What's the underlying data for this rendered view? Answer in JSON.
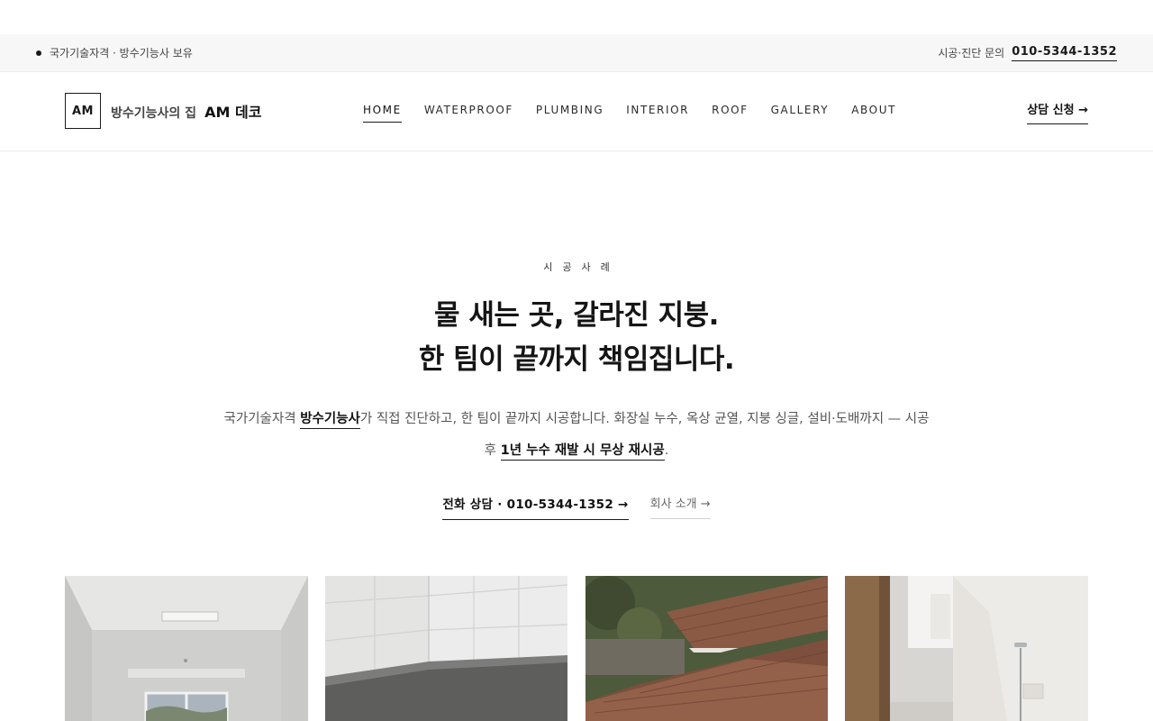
{
  "topbar": {
    "badge_text": "국가기술자격 · 방수기능사 보유",
    "inquiry_label": "시공·진단 문의",
    "phone": "010-5344-1352"
  },
  "header": {
    "logo_mark": "AM",
    "brand_prefix": "방수기능사의 집",
    "brand_name": "AM 데코",
    "nav": [
      {
        "label": "HOME",
        "active": true
      },
      {
        "label": "WATERPROOF"
      },
      {
        "label": "PLUMBING"
      },
      {
        "label": "INTERIOR"
      },
      {
        "label": "ROOF"
      },
      {
        "label": "GALLERY"
      },
      {
        "label": "ABOUT"
      }
    ],
    "cta_label": "상담 신청 →"
  },
  "hero": {
    "eyebrow": "시공사례",
    "headline_line1": "물 새는 곳, 갈라진 지붕.",
    "headline_line2": "한 팀이 끝까지 책임집니다.",
    "desc_part1": "국가기술자격 ",
    "desc_highlight1": "방수기능사",
    "desc_part2": "가 직접 진단하고, 한 팀이 끝까지 시공합니다. 화장실 누수, 옥상 균열, 지붕 싱글, 설비·도배까지 — 시공 후 ",
    "desc_highlight2": "1년 누수 재발 시 무상 재시공",
    "desc_part3": ".",
    "call_button": "전화 상담 · 010-5344-1352 →",
    "about_button": "회사 소개 →"
  },
  "gallery": {
    "tiles": [
      "bright-room",
      "tiled-bathroom",
      "shingle-roof",
      "modern-bathroom"
    ]
  }
}
